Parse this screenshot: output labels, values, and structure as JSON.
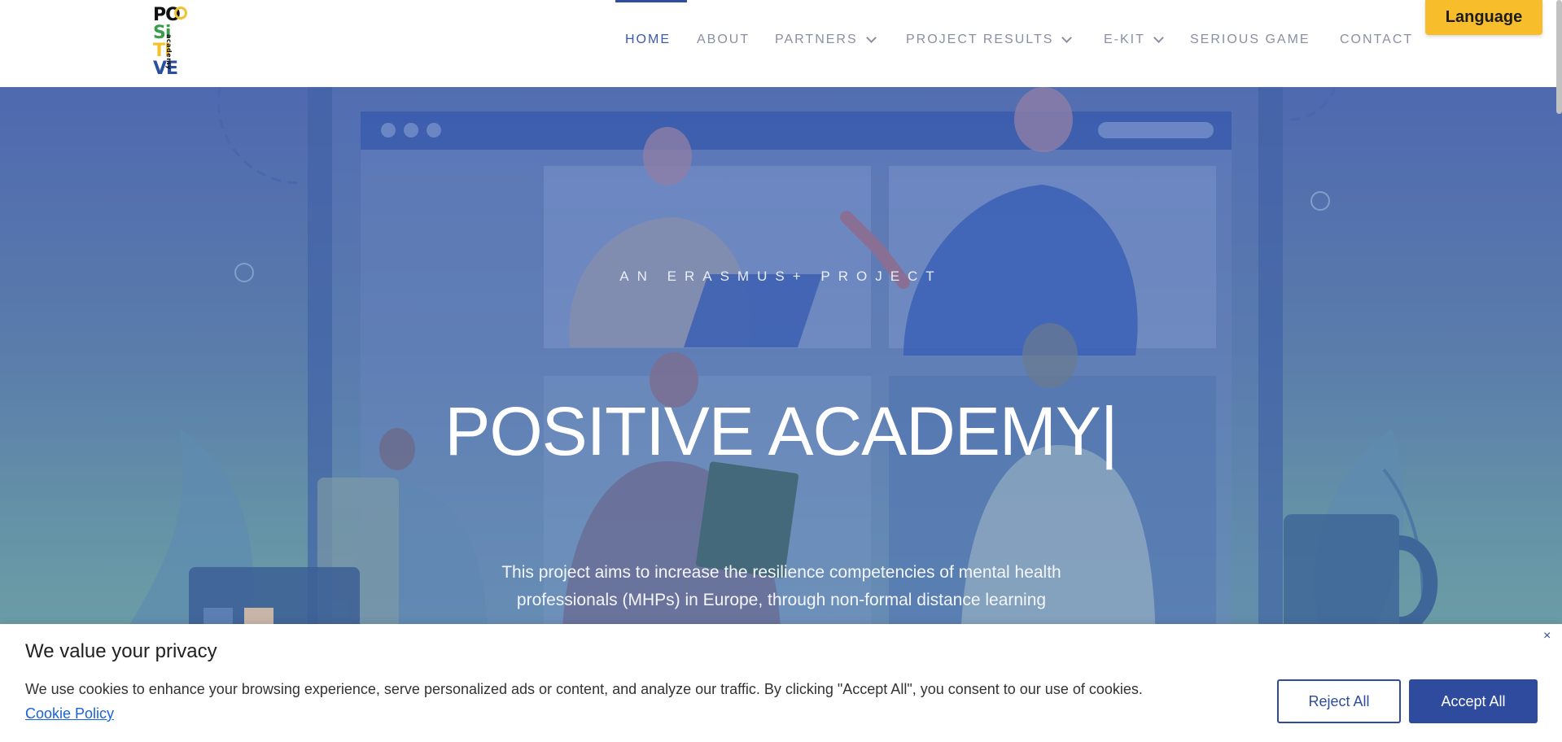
{
  "logo": {
    "line1": "PO",
    "line2a": "S",
    "line2b": "i",
    "line3": "TI",
    "line4": "VE",
    "side": "academy"
  },
  "nav": {
    "items": [
      {
        "label": "HOME",
        "active": true,
        "dropdown": false
      },
      {
        "label": "ABOUT",
        "active": false,
        "dropdown": false
      },
      {
        "label": "PARTNERS",
        "active": false,
        "dropdown": true
      },
      {
        "label": "PROJECT RESULTS",
        "active": false,
        "dropdown": true
      },
      {
        "label": "E-KIT",
        "active": false,
        "dropdown": true
      },
      {
        "label": "SERIOUS GAME",
        "active": false,
        "dropdown": false
      },
      {
        "label": "CONTACT",
        "active": false,
        "dropdown": false
      }
    ]
  },
  "language_button": "Language",
  "hero": {
    "subtitle": "AN ERASMUS+ PROJECT",
    "title": "POSITIVE ACADEMY|",
    "description": "This project aims to increase the resilience competencies of mental health professionals (MHPs) in Europe, through non-formal distance learning"
  },
  "cookie": {
    "title": "We value your privacy",
    "text": "We use cookies to enhance your browsing experience, serve personalized ads or content, and analyze our traffic. By clicking \"Accept All\", you consent to our use of cookies.",
    "link": "Cookie Policy",
    "reject": "Reject All",
    "accept": "Accept All",
    "close": "×"
  },
  "colors": {
    "accent": "#2e4b9e",
    "language": "#f7bd2b"
  }
}
